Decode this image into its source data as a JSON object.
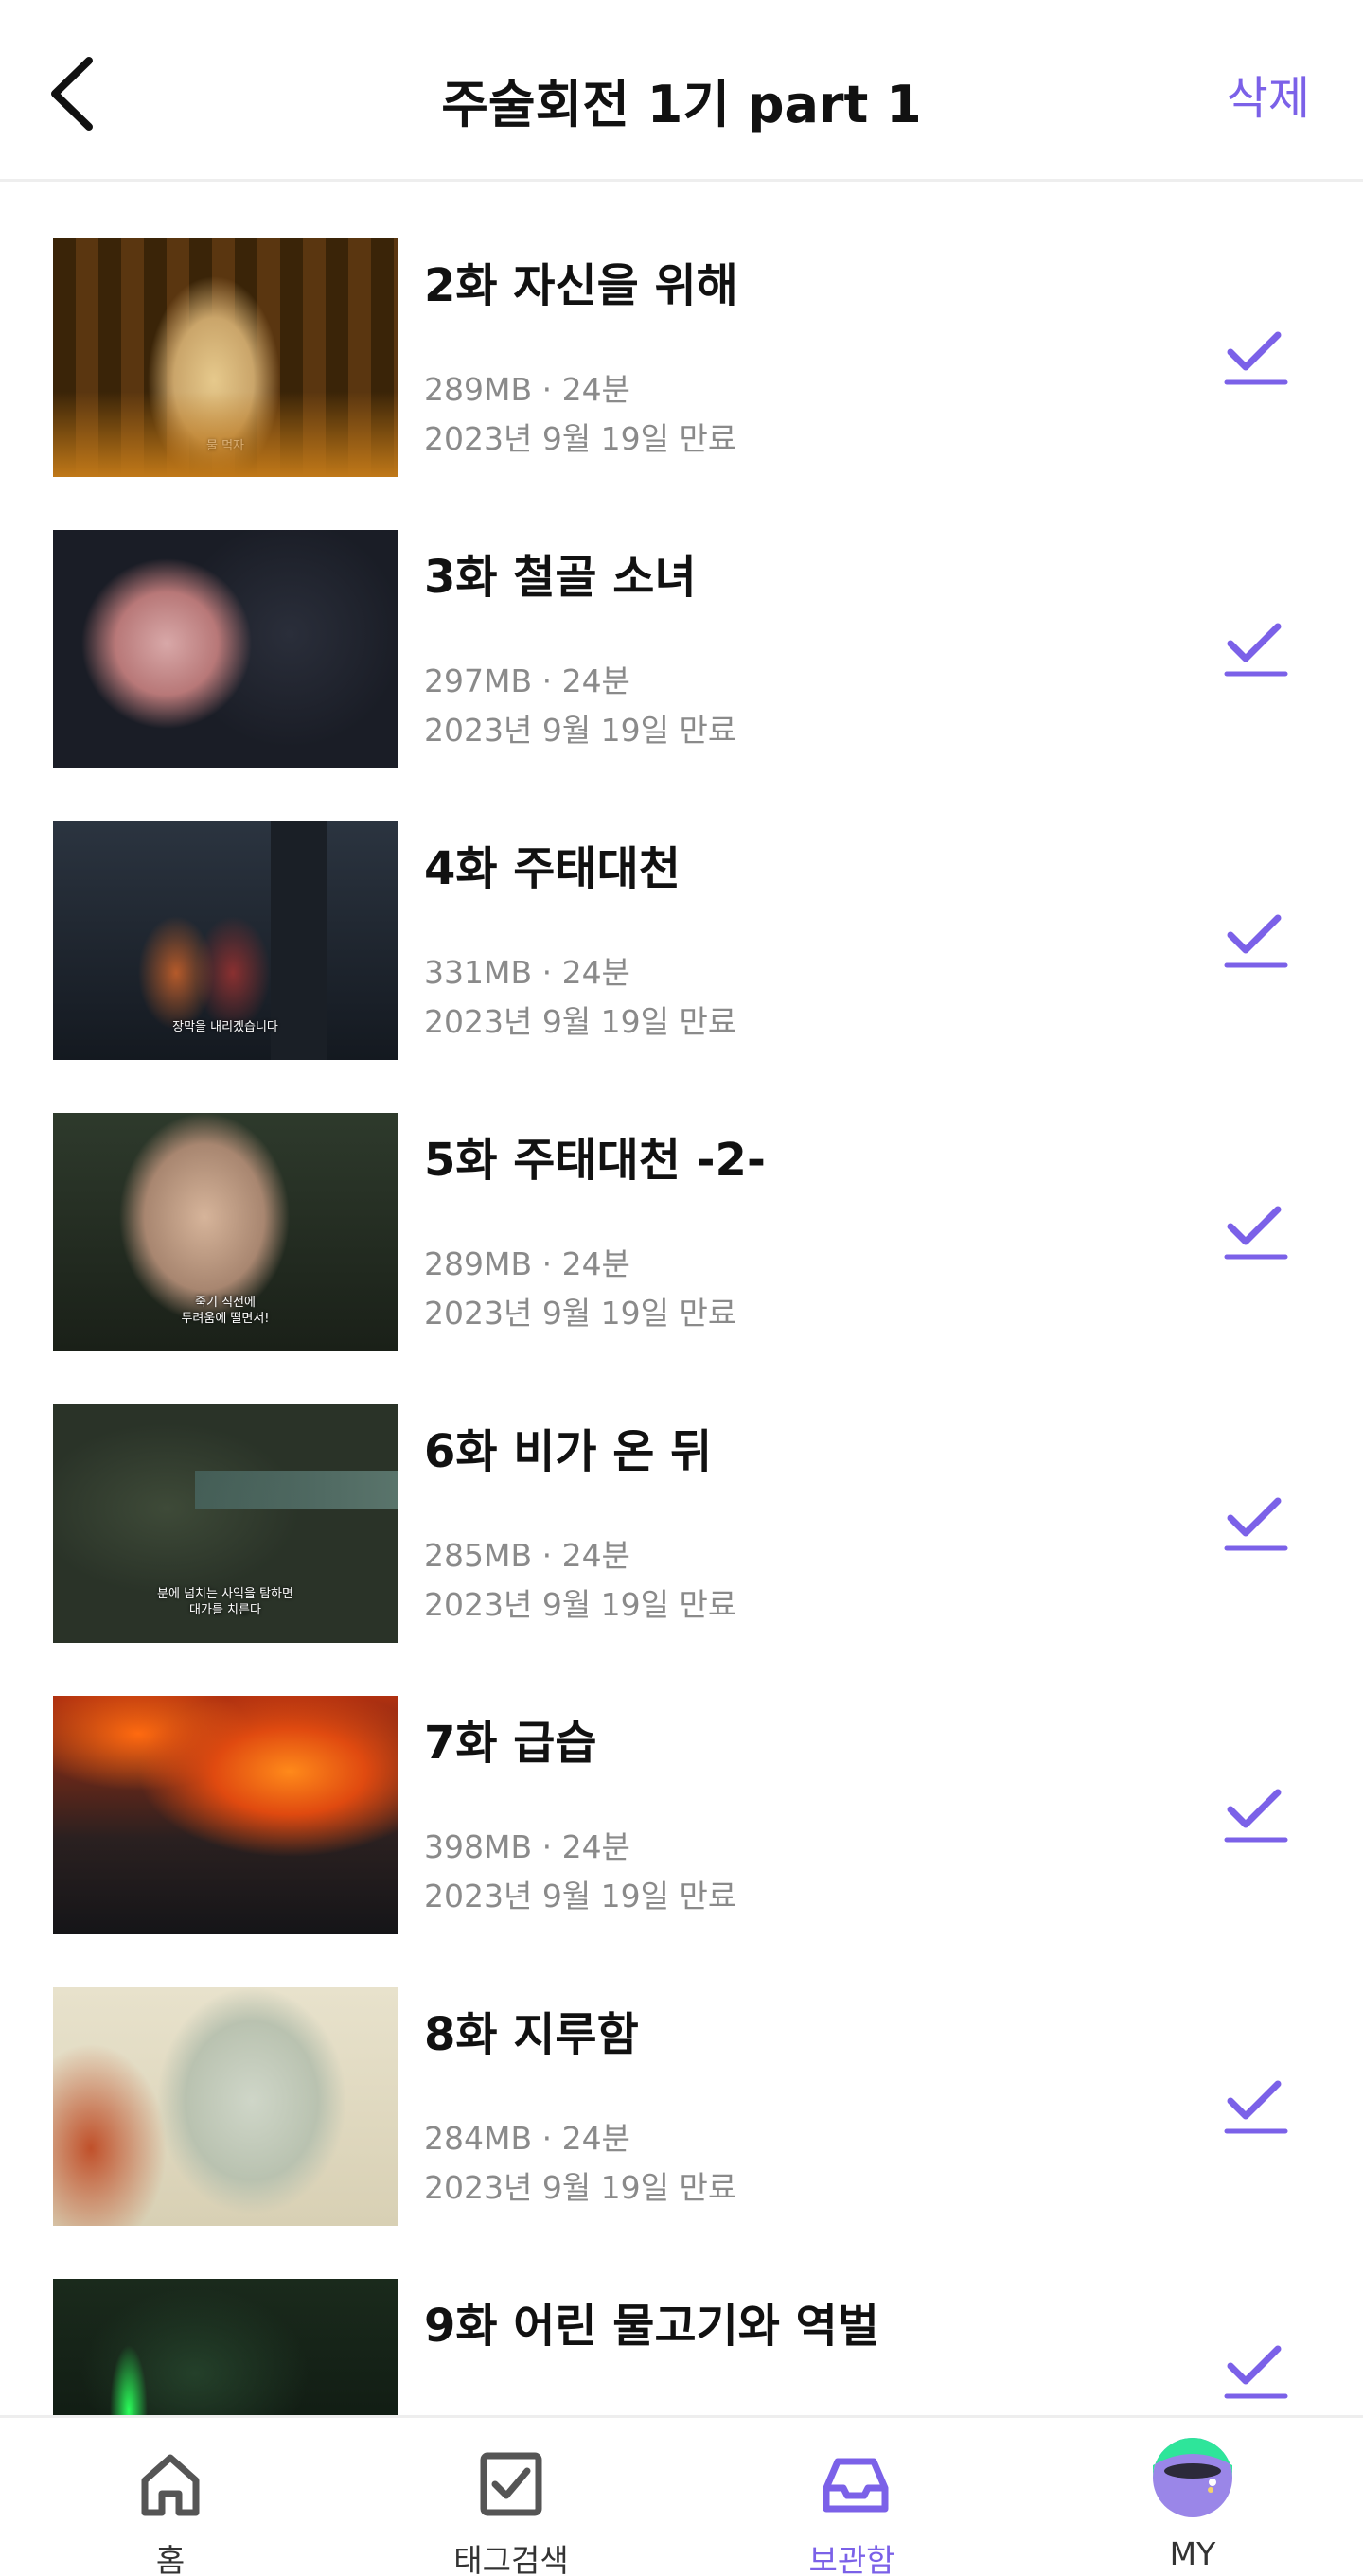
{
  "header": {
    "title": "주술회전 1기 part 1",
    "delete_label": "삭제"
  },
  "colors": {
    "accent": "#7B61E8",
    "meta_text": "#8A8A8A",
    "title_text": "#111111"
  },
  "episodes": [
    {
      "title": "2화 자신을 위해",
      "size_duration": "289MB · 24분",
      "expiry": "2023년 9월 19일 만료",
      "subtitle": "물 먹자"
    },
    {
      "title": "3화 철골 소녀",
      "size_duration": "297MB · 24분",
      "expiry": "2023년 9월 19일 만료",
      "subtitle": ""
    },
    {
      "title": "4화 주태대천",
      "size_duration": "331MB · 24분",
      "expiry": "2023년 9월 19일 만료",
      "subtitle": "장막을 내리겠습니다"
    },
    {
      "title": "5화 주태대천 -2-",
      "size_duration": "289MB · 24분",
      "expiry": "2023년 9월 19일 만료",
      "subtitle": "죽기 직전에\n두려움에 떨면서!"
    },
    {
      "title": "6화 비가 온 뒤",
      "size_duration": "285MB · 24분",
      "expiry": "2023년 9월 19일 만료",
      "subtitle": "분에 넘치는 사익을 탐하면\n대가를 치른다"
    },
    {
      "title": "7화 급습",
      "size_duration": "398MB · 24분",
      "expiry": "2023년 9월 19일 만료",
      "subtitle": ""
    },
    {
      "title": "8화 지루함",
      "size_duration": "284MB · 24분",
      "expiry": "2023년 9월 19일 만료",
      "subtitle": ""
    },
    {
      "title": "9화 어린 물고기와 역벌",
      "size_duration": "",
      "expiry": "",
      "subtitle": ""
    }
  ],
  "nav": {
    "home": "홈",
    "tag_search": "태그검색",
    "storage": "보관함",
    "my": "MY"
  }
}
